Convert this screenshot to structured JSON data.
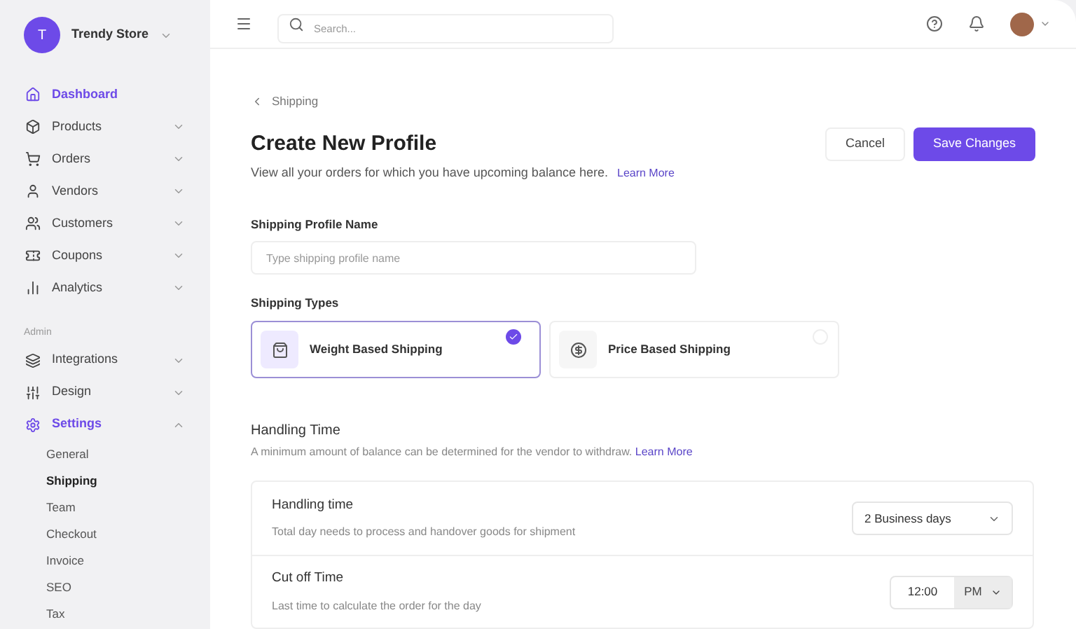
{
  "store": {
    "initial": "T",
    "name": "Trendy Store"
  },
  "nav": [
    {
      "label": "Dashboard",
      "kind": "link",
      "selected": true,
      "expanded": false
    },
    {
      "label": "Products",
      "kind": "group",
      "selected": false,
      "expanded": false
    },
    {
      "label": "Orders",
      "kind": "group",
      "selected": false,
      "expanded": false
    },
    {
      "label": "Vendors",
      "kind": "group",
      "selected": false,
      "expanded": false
    },
    {
      "label": "Customers",
      "kind": "group",
      "selected": false,
      "expanded": false
    },
    {
      "label": "Coupons",
      "kind": "group",
      "selected": false,
      "expanded": false
    },
    {
      "label": "Analytics",
      "kind": "group",
      "selected": false,
      "expanded": false
    }
  ],
  "admin_heading": "Admin",
  "admin_nav": [
    {
      "label": "Integrations",
      "kind": "group",
      "selected": false,
      "expanded": false
    },
    {
      "label": "Design",
      "kind": "group",
      "selected": false,
      "expanded": false
    },
    {
      "label": "Settings",
      "kind": "group",
      "selected": true,
      "expanded": true,
      "children": [
        {
          "label": "General",
          "selected": false
        },
        {
          "label": "Shipping",
          "selected": true
        },
        {
          "label": "Team",
          "selected": false
        },
        {
          "label": "Checkout",
          "selected": false
        },
        {
          "label": "Invoice",
          "selected": false
        },
        {
          "label": "SEO",
          "selected": false
        },
        {
          "label": "Tax",
          "selected": false
        }
      ]
    }
  ],
  "search": {
    "placeholder": "Search..."
  },
  "breadcrumb": "Shipping",
  "title": "Create New Profile",
  "subtitle": "View all your orders for which you have upcoming balance here.",
  "subtitle_link": "Learn More",
  "buttons": {
    "cancel": "Cancel",
    "save": "Save Changes"
  },
  "profile_name": {
    "label": "Shipping Profile Name",
    "placeholder": "Type shipping profile name"
  },
  "shipping_types": {
    "label": "Shipping Types",
    "options": [
      {
        "label": "Weight Based Shipping",
        "selected": true
      },
      {
        "label": "Price Based Shipping",
        "selected": false
      }
    ]
  },
  "handling": {
    "title": "Handling Time",
    "description": "A minimum amount of balance can be determined for the vendor to withdraw.",
    "link": "Learn More",
    "rows": [
      {
        "kind": "select",
        "title": "Handling time",
        "description": "Total day needs to process and handover goods for shipment",
        "value": "2 Business days"
      },
      {
        "kind": "time",
        "title": "Cut off Time",
        "description": "Last time to calculate the order for the day",
        "value": "12:00",
        "period": "PM"
      }
    ]
  }
}
